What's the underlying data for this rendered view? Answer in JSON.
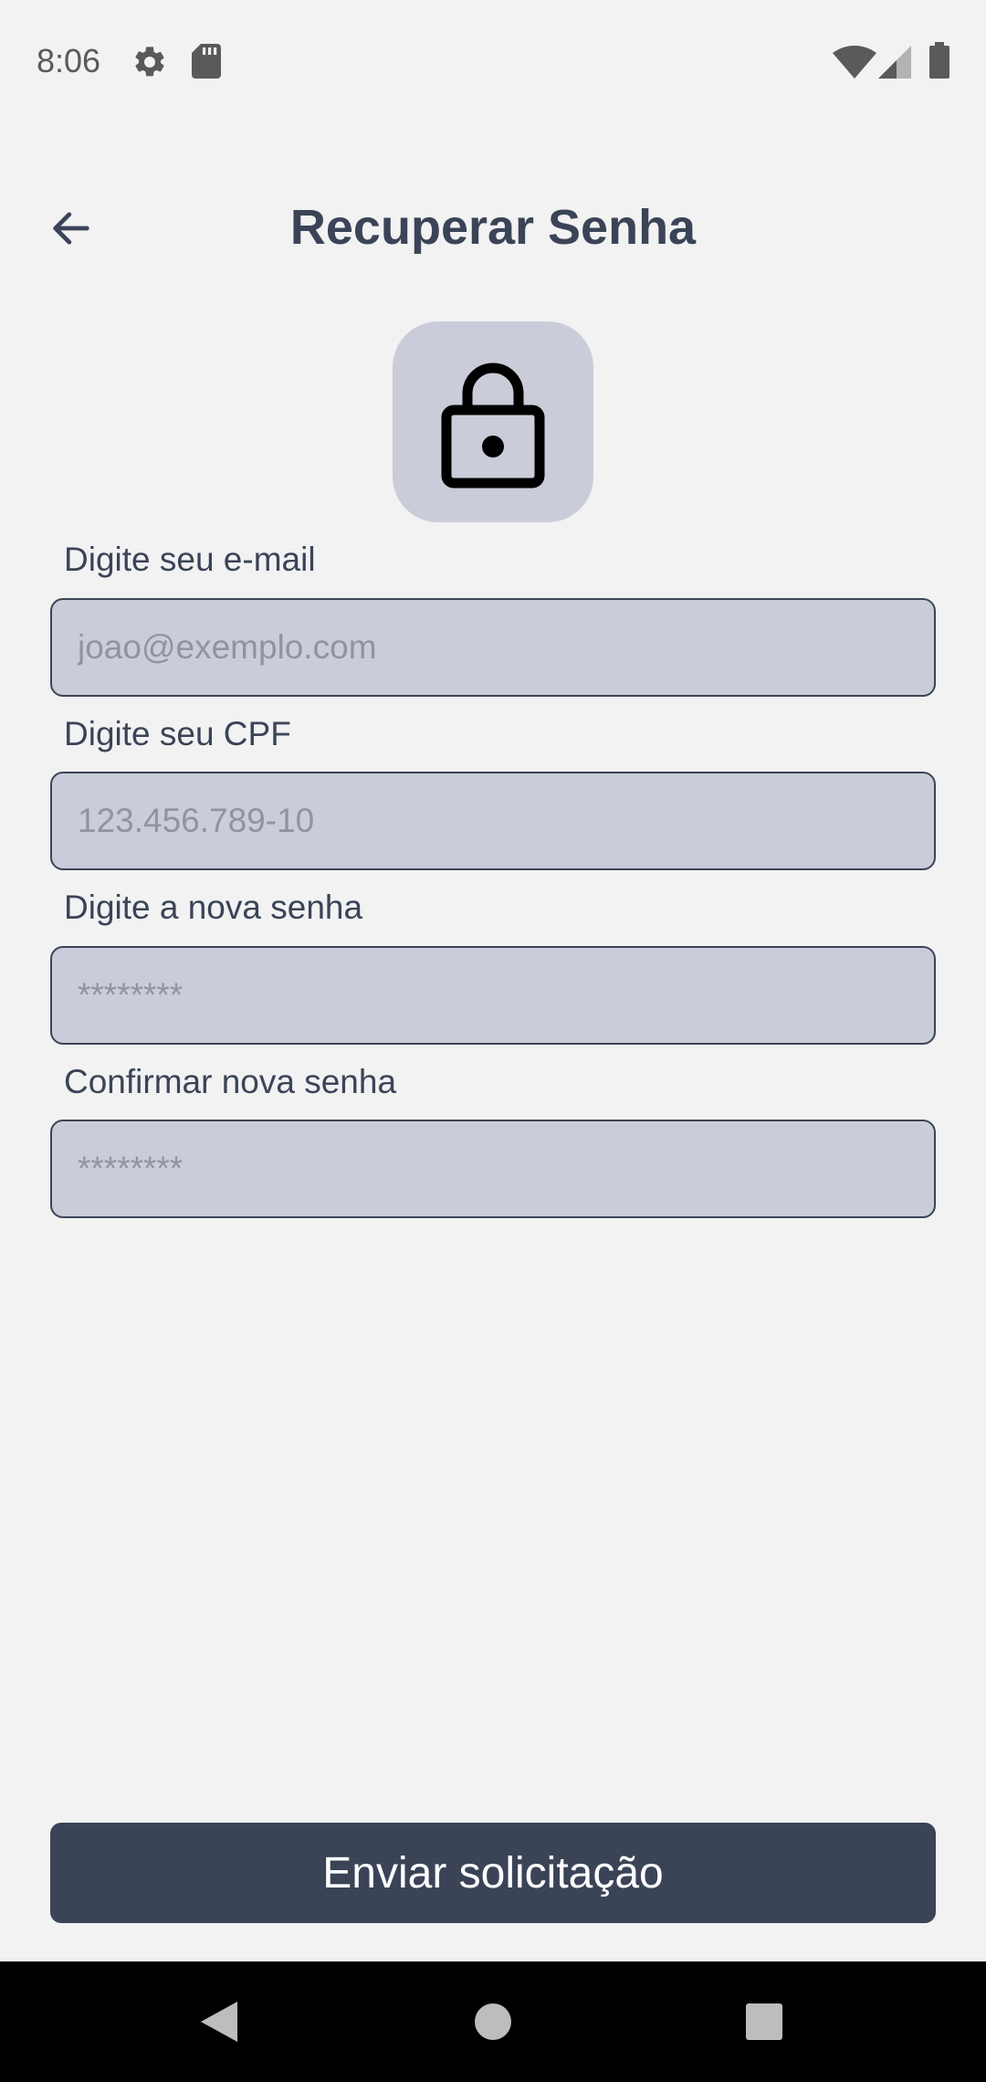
{
  "status_bar": {
    "time": "8:06",
    "icons": [
      "gear-icon",
      "sd-card-icon",
      "wifi-icon",
      "signal-icon",
      "battery-icon"
    ]
  },
  "header": {
    "title": "Recuperar Senha",
    "back_icon": "arrow-left-icon"
  },
  "hero_icon": "lock-icon",
  "form": {
    "email": {
      "label": "Digite seu e-mail",
      "placeholder": "joao@exemplo.com",
      "value": ""
    },
    "cpf": {
      "label": "Digite seu CPF",
      "placeholder": "123.456.789-10",
      "value": ""
    },
    "new_password": {
      "label": "Digite a nova senha",
      "placeholder": "********",
      "value": ""
    },
    "confirm_password": {
      "label": "Confirmar nova senha",
      "placeholder": "********",
      "value": ""
    }
  },
  "submit_label": "Enviar solicitação",
  "nav_bar": {
    "icons": [
      "nav-back-icon",
      "nav-home-icon",
      "nav-recents-icon"
    ]
  },
  "colors": {
    "background": "#f2f2f3",
    "primary": "#3b4457",
    "field_fill": "#cacdd9",
    "placeholder": "#8f94a3",
    "nav_bar": "#000000"
  }
}
